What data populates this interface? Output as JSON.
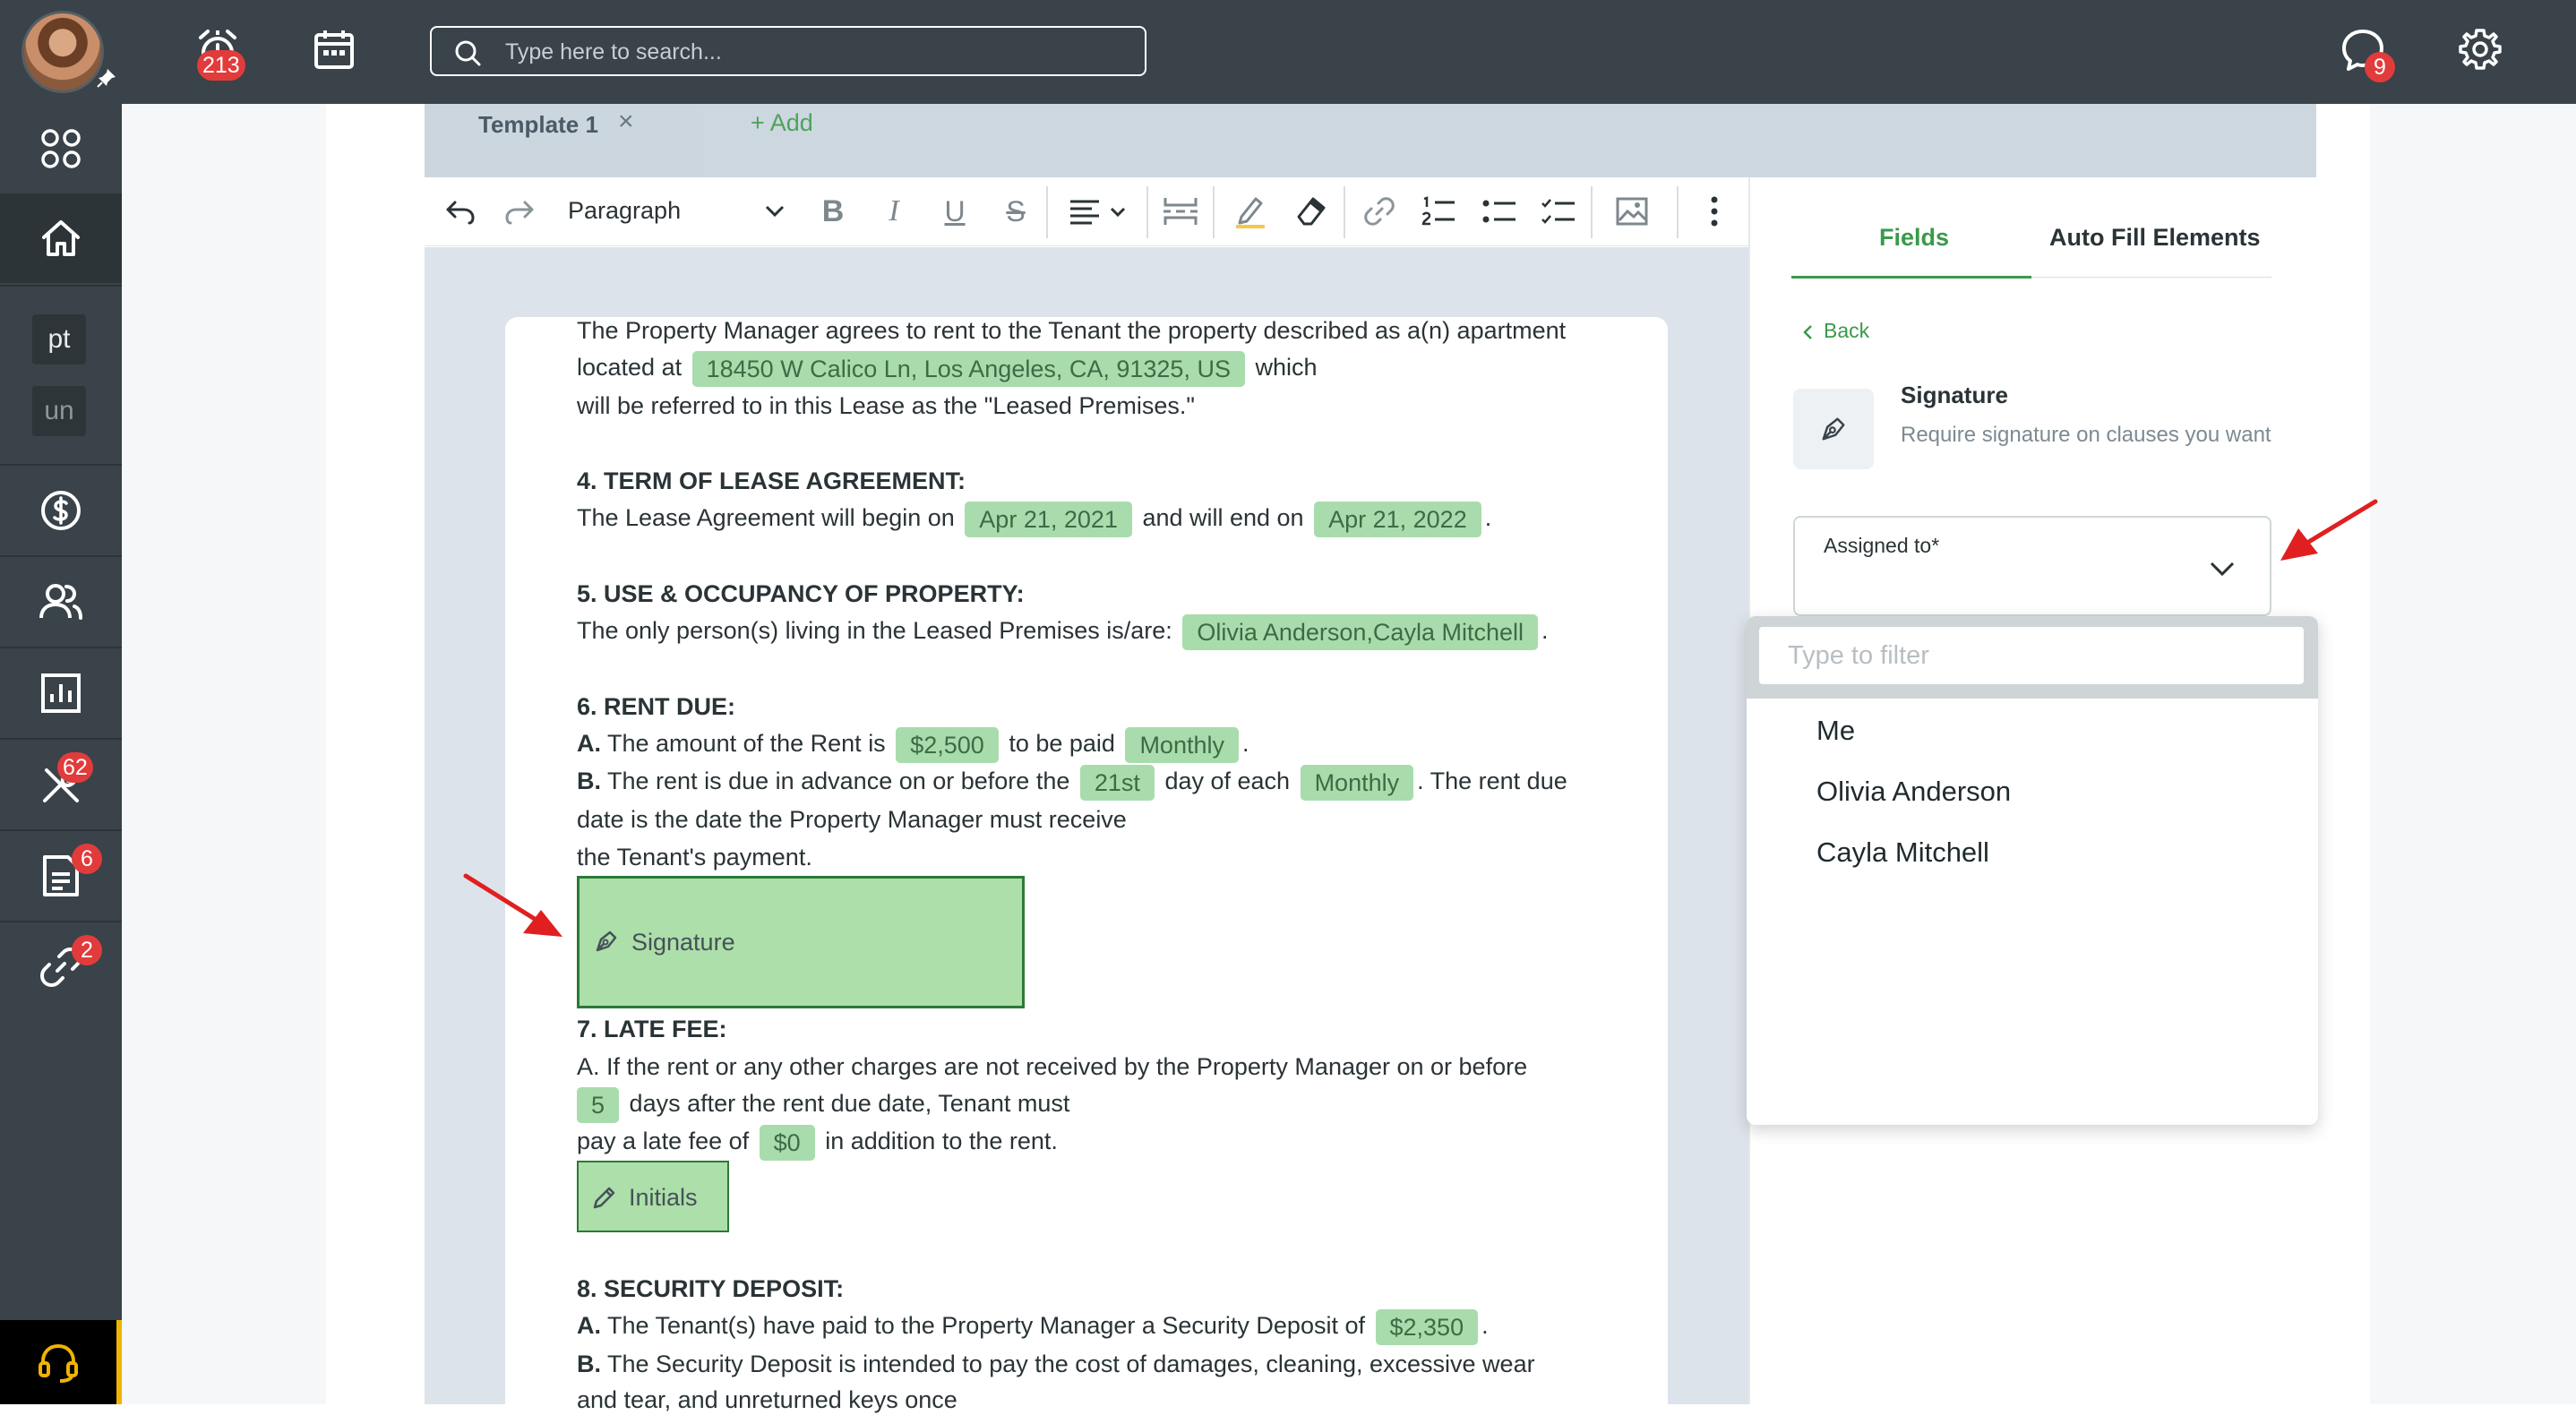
{
  "topbar": {
    "notifications_badge": "213",
    "search_placeholder": "Type here to search...",
    "chat_badge": "9"
  },
  "sidebar": {
    "items": [
      {
        "name": "apps",
        "icon": "grid-icon"
      },
      {
        "name": "home",
        "icon": "home-icon",
        "active": true
      },
      {
        "name": "pt",
        "label": "pt"
      },
      {
        "name": "un",
        "label": "un"
      },
      {
        "name": "accounting",
        "icon": "dollar-icon"
      },
      {
        "name": "people",
        "icon": "people-icon"
      },
      {
        "name": "reports",
        "icon": "chart-icon"
      },
      {
        "name": "maintenance",
        "icon": "tools-icon",
        "badge": "62"
      },
      {
        "name": "documents",
        "icon": "document-icon",
        "badge": "6"
      },
      {
        "name": "links",
        "icon": "link-icon",
        "badge": "2"
      }
    ]
  },
  "tabs": {
    "active_label": "Template 1",
    "close_glyph": "×",
    "add_label": "+ Add"
  },
  "toolbar": {
    "paragraph_style": "Paragraph",
    "bold": "B",
    "italic": "I",
    "underline": "U",
    "strike": "S"
  },
  "document": {
    "p1_line1": "The Property Manager agrees to rent to the Tenant the property described as a(n) apartment",
    "p1_line2_pre": "located at",
    "address_chip": "18450 W Calico Ln, Los Angeles, CA, 91325, US",
    "p1_line2_post": "which",
    "p1_line3": "will be referred to in this Lease as the \"Leased Premises.\"",
    "h4": "4. TERM OF LEASE AGREEMENT:",
    "term_pre": "The Lease Agreement will begin on",
    "start_date_chip": "Apr 21, 2021",
    "term_mid": "and will end on",
    "end_date_chip": "Apr 21, 2022",
    "term_post": ".",
    "h5": "5. USE & OCCUPANCY OF PROPERTY:",
    "occupancy_pre": "The only person(s) living in the Leased Premises is/are:",
    "occupants_chip": "Olivia Anderson,Cayla Mitchell",
    "occupancy_post": ".",
    "h6": "6. RENT DUE:",
    "rent_a_label": "A.",
    "rent_a_pre": "The amount of the Rent is",
    "rent_amount_chip": "$2,500",
    "rent_a_mid": "to be paid",
    "rent_freq_chip": "Monthly",
    "rent_a_post": ".",
    "rent_b_label": "B.",
    "rent_b_pre": "The rent is due in advance on or before the",
    "due_day_chip": "21st",
    "rent_b_mid": "day of each",
    "due_period_chip": "Monthly",
    "rent_b_post": ". The rent due",
    "rent_b_line2": "date is the date the Property Manager must receive",
    "rent_b_line3": "the Tenant's payment.",
    "signature_field": "Signature",
    "h7": "7. LATE FEE:",
    "late_line1": "A. If the rent or any other charges are not received by the Property Manager on or before",
    "late_days_chip": "5",
    "late_line2_post": "days after the rent due date, Tenant must",
    "late_line3_pre": "pay a late fee of",
    "late_fee_chip": "$0",
    "late_line3_post": "in addition to the rent.",
    "initials_field": "Initials",
    "h8": "8. SECURITY DEPOSIT:",
    "dep_a_label": "A.",
    "dep_a_pre": "The Tenant(s) have paid to the Property Manager a Security Deposit of",
    "deposit_chip": "$2,350",
    "dep_a_post": ".",
    "dep_b_label": "B.",
    "dep_b_text": "The Security Deposit is intended to pay the cost of damages, cleaning, excessive wear",
    "dep_b_line2": "and tear, and unreturned keys once"
  },
  "panel": {
    "tab_fields": "Fields",
    "tab_autofill": "Auto Fill Elements",
    "back_label": "Back",
    "field_title": "Signature",
    "field_desc": "Require signature on clauses you want",
    "assigned_label": "Assigned to*",
    "filter_placeholder": "Type to filter",
    "options": [
      "Me",
      "Olivia Anderson",
      "Cayla Mitchell"
    ]
  },
  "colors": {
    "topbar": "#394349",
    "accent_green": "#3a9a4a",
    "chip_green": "#a8dcad",
    "badge_red": "#e23b3b",
    "annotation_arrow": "#e02020"
  }
}
